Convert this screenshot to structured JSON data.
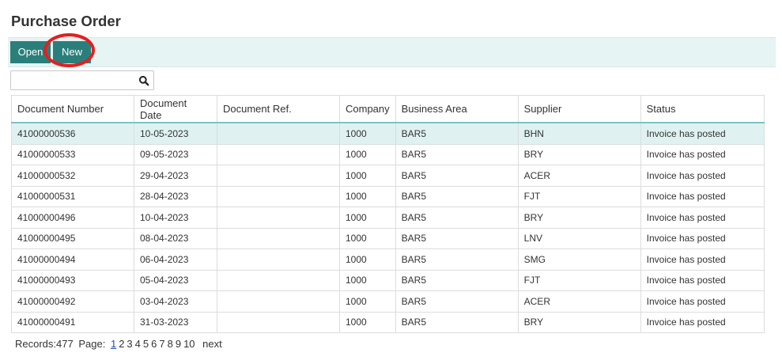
{
  "page": {
    "title": "Purchase Order"
  },
  "toolbar": {
    "open_label": "Open",
    "new_label": "New"
  },
  "search": {
    "value": "",
    "placeholder": ""
  },
  "colors": {
    "accent": "#2a7f7b",
    "toolbar_bg": "#e6f4f3",
    "highlight": "#e41f1f",
    "selected_row": "#dff2f1"
  },
  "icons": {
    "search": "search-icon"
  },
  "table": {
    "columns": [
      "Document Number",
      "Document Date",
      "Document Ref.",
      "Company",
      "Business Area",
      "Supplier",
      "Status"
    ],
    "rows": [
      [
        "41000000536",
        "10-05-2023",
        "",
        "1000",
        "BAR5",
        "BHN",
        "Invoice has posted"
      ],
      [
        "41000000533",
        "09-05-2023",
        "",
        "1000",
        "BAR5",
        "BRY",
        "Invoice has posted"
      ],
      [
        "41000000532",
        "29-04-2023",
        "",
        "1000",
        "BAR5",
        "ACER",
        "Invoice has posted"
      ],
      [
        "41000000531",
        "28-04-2023",
        "",
        "1000",
        "BAR5",
        "FJT",
        "Invoice has posted"
      ],
      [
        "41000000496",
        "10-04-2023",
        "",
        "1000",
        "BAR5",
        "BRY",
        "Invoice has posted"
      ],
      [
        "41000000495",
        "08-04-2023",
        "",
        "1000",
        "BAR5",
        "LNV",
        "Invoice has posted"
      ],
      [
        "41000000494",
        "06-04-2023",
        "",
        "1000",
        "BAR5",
        "SMG",
        "Invoice has posted"
      ],
      [
        "41000000493",
        "05-04-2023",
        "",
        "1000",
        "BAR5",
        "FJT",
        "Invoice has posted"
      ],
      [
        "41000000492",
        "03-04-2023",
        "",
        "1000",
        "BAR5",
        "ACER",
        "Invoice has posted"
      ],
      [
        "41000000491",
        "31-03-2023",
        "",
        "1000",
        "BAR5",
        "BRY",
        "Invoice has posted"
      ]
    ],
    "selected_row": 0
  },
  "pager": {
    "records_label": "Records:477",
    "page_label": "Page:",
    "pages": [
      "1",
      "2",
      "3",
      "4",
      "5",
      "6",
      "7",
      "8",
      "9",
      "10"
    ],
    "current_page": "1",
    "next_label": "next"
  }
}
